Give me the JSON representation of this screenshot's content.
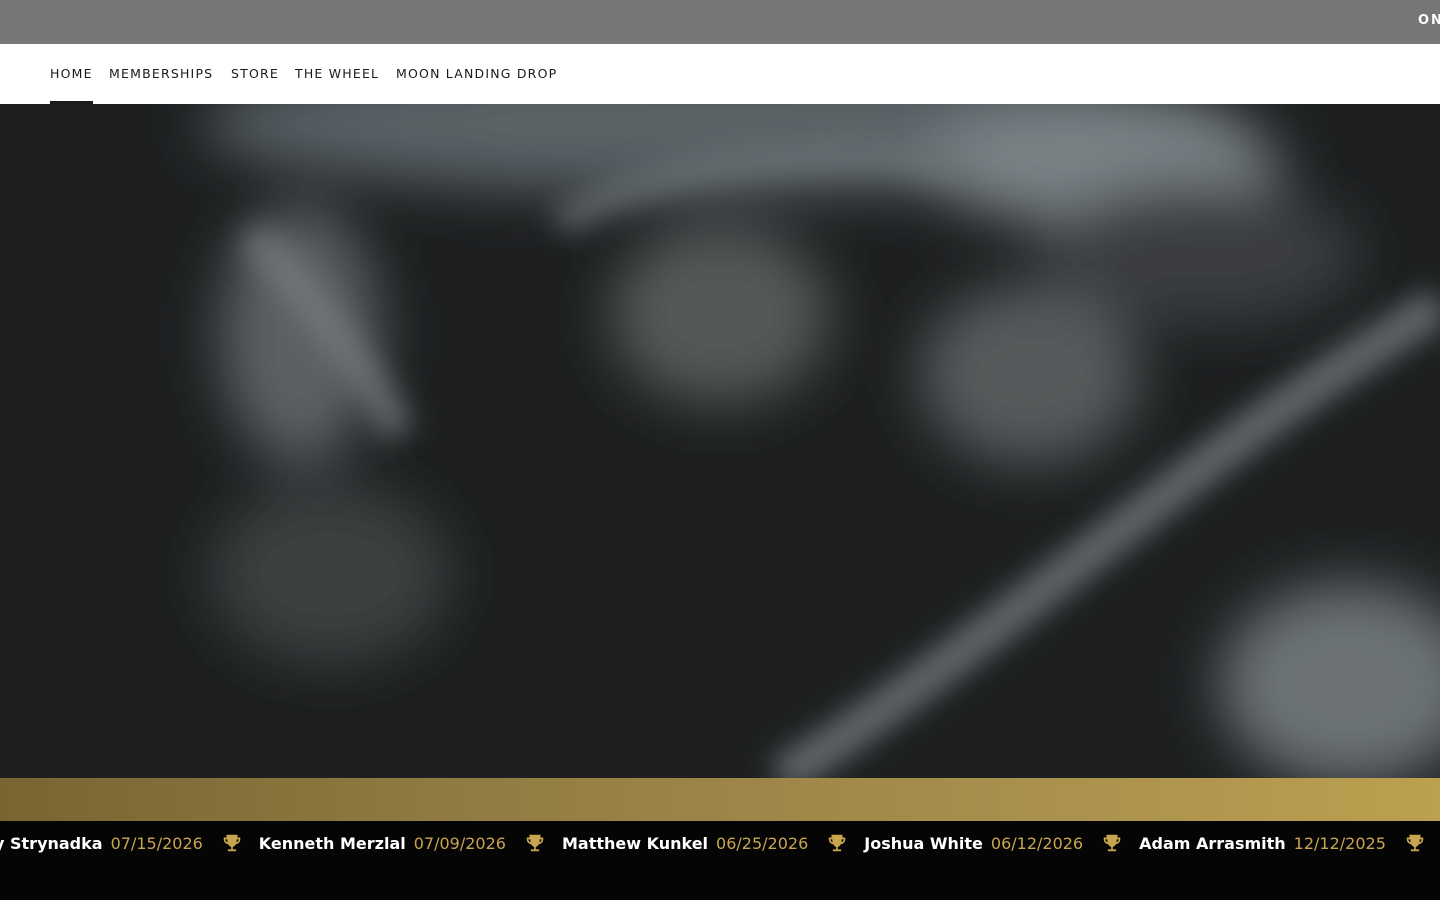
{
  "announcement": {
    "text": "ON"
  },
  "nav": {
    "items": [
      {
        "label": "HOME"
      },
      {
        "label": "MEMBERSHIPS"
      },
      {
        "label": "STORE"
      },
      {
        "label": "THE WHEEL"
      },
      {
        "label": "MOON LANDING DROP"
      }
    ],
    "active_index": 0
  },
  "ticker": {
    "winners": [
      {
        "name": "y Strynadka",
        "date": "07/15/2026"
      },
      {
        "name": "Kenneth Merzlal",
        "date": "07/09/2026"
      },
      {
        "name": "Matthew Kunkel",
        "date": "06/25/2026"
      },
      {
        "name": "Joshua White",
        "date": "06/12/2026"
      },
      {
        "name": "Adam Arrasmith",
        "date": "12/12/2025"
      }
    ],
    "icon": "trophy-icon"
  },
  "colors": {
    "announcement_bg": "#777777",
    "gold": "#c9a54f",
    "ticker_bg": "#050505"
  }
}
